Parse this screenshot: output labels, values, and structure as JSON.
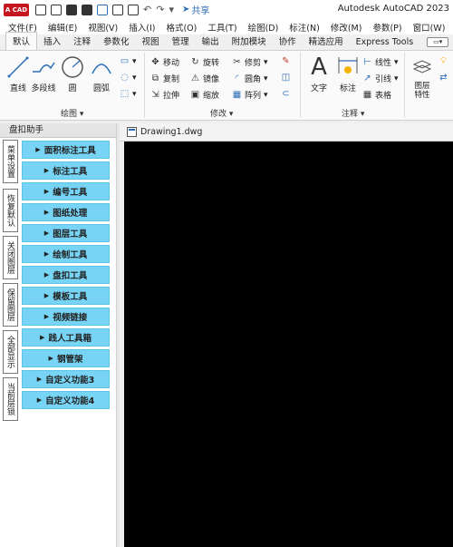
{
  "titlebar": {
    "logo": "A CAD",
    "share": "共享",
    "title": "Autodesk AutoCAD 2023"
  },
  "menu": [
    "文件(F)",
    "编辑(E)",
    "视图(V)",
    "插入(I)",
    "格式(O)",
    "工具(T)",
    "绘图(D)",
    "标注(N)",
    "修改(M)",
    "参数(P)",
    "窗口(W)"
  ],
  "ribbon_tabs": [
    "默认",
    "插入",
    "注释",
    "参数化",
    "视图",
    "管理",
    "输出",
    "附加模块",
    "协作",
    "精选应用",
    "Express Tools"
  ],
  "ribbon": {
    "draw": {
      "line": "直线",
      "polyline": "多段线",
      "circle": "圆",
      "arc": "圆弧",
      "title": "绘图 ▾"
    },
    "modify": {
      "move": "移动",
      "rotate": "旋转",
      "trim": "修剪",
      "copy": "复制",
      "mirror": "镜像",
      "fillet": "圆角",
      "stretch": "拉伸",
      "scale": "缩放",
      "array": "阵列",
      "title": "修改 ▾"
    },
    "annotation": {
      "text": "文字",
      "dimension": "标注",
      "linear": "线性",
      "leader": "引线",
      "table": "表格",
      "title": "注释 ▾"
    },
    "layers": {
      "layer_props": "图层\n特性"
    }
  },
  "palette": {
    "title": "盘扣助手",
    "vtabs": [
      "菜单设置",
      "恢复默认",
      "关闭图层",
      "保留图层",
      "全部显示",
      "当前层锁"
    ],
    "tools": [
      "面积标注工具",
      "标注工具",
      "编号工具",
      "图纸处理",
      "图层工具",
      "绘制工具",
      "盘扣工具",
      "模板工具",
      "视频链接",
      "践人工具箱",
      "钢管架",
      "自定义功能3",
      "自定义功能4"
    ]
  },
  "drawing": {
    "tab": "Drawing1.dwg"
  }
}
